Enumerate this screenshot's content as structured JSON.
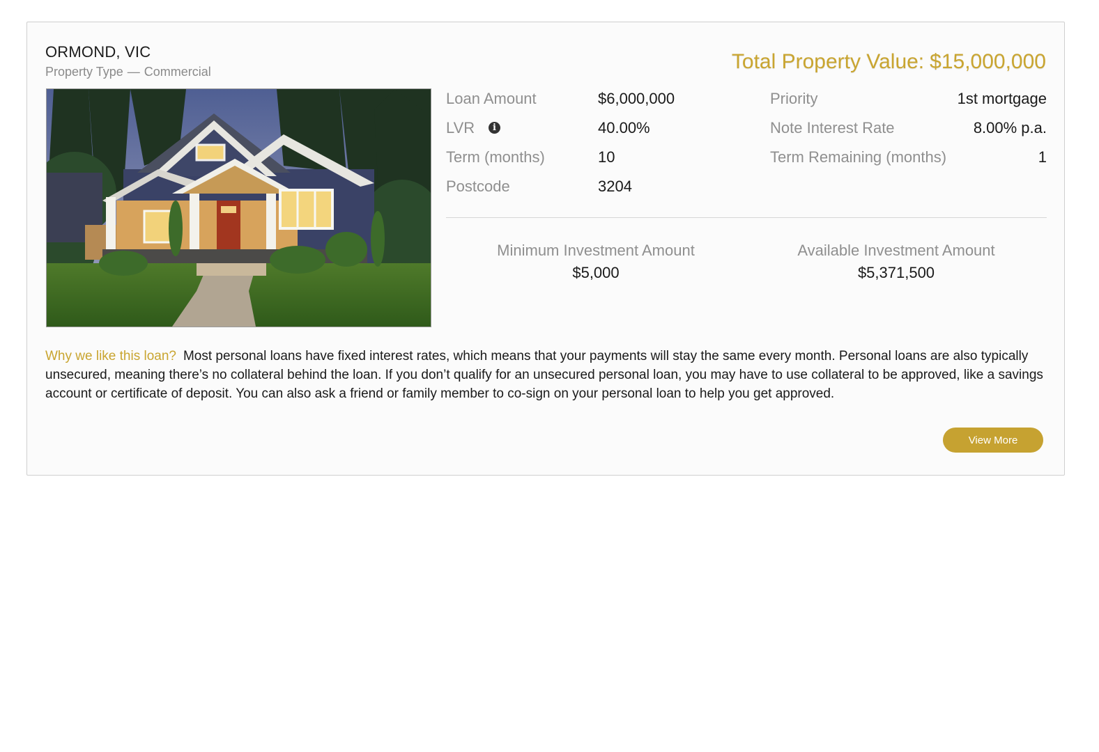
{
  "listing": {
    "location": "ORMOND, VIC",
    "property_type_label": "Property Type",
    "property_type_dash": "—",
    "property_type_value": "Commercial",
    "total_label": "Total Property Value:",
    "total_value": "$15,000,000"
  },
  "stats_left": [
    {
      "label": "Loan Amount",
      "value": "$6,000,000"
    },
    {
      "label": "LVR",
      "value": "40.00%"
    },
    {
      "label": "Term (months)",
      "value": "10"
    },
    {
      "label": "Postcode",
      "value": "3204"
    }
  ],
  "stats_right": [
    {
      "label": "Priority",
      "value": "1st mortgage"
    },
    {
      "label": "Note Interest Rate",
      "value": "8.00% p.a."
    },
    {
      "label": "Term Remaining (months)",
      "value": "1"
    }
  ],
  "investment": {
    "min_label": "Minimum Investment Amount",
    "min_value": "$5,000",
    "avail_label": "Available Investment Amount",
    "avail_value": "$5,371,500"
  },
  "why": {
    "question": "Why we like this loan?",
    "text": "Most personal loans have fixed interest rates, which means that your payments will stay the same every month. Personal loans are also typically unsecured, meaning there’s no collateral behind the loan. If you don’t qualify for an unsecured personal loan, you may have to use collateral to be approved, like a savings account or certificate of deposit. You can also ask a friend or family member to co-sign on your personal loan to help you get approved."
  },
  "actions": {
    "view_more": "View More"
  },
  "icons": {
    "lvr_info": "info-icon"
  },
  "colors": {
    "accent": "#c9a530",
    "button": "#c6a231",
    "label_gray": "#8f8f8f"
  }
}
